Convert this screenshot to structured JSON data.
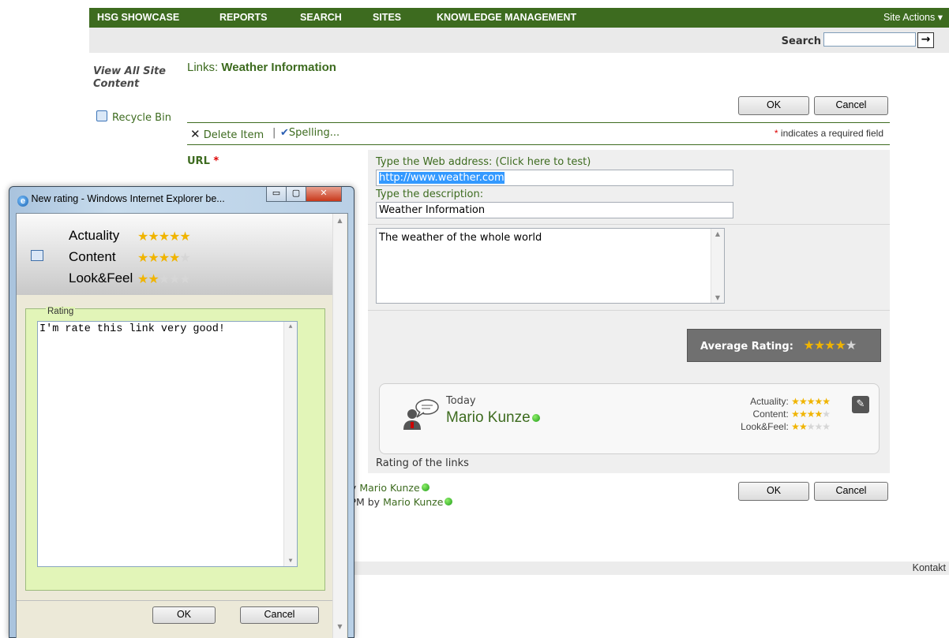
{
  "nav": {
    "items": [
      "HSG SHOWCASE",
      "REPORTS",
      "SEARCH",
      "SITES",
      "KNOWLEDGE MANAGEMENT"
    ],
    "site_actions": "Site Actions ▾"
  },
  "search": {
    "label": "Search",
    "value": "",
    "go_symbol": "→"
  },
  "leftnav": {
    "view_all": "View All Site Content",
    "recycle_bin": "Recycle Bin"
  },
  "page": {
    "title_prefix": "Links: ",
    "title_name": "Weather Information"
  },
  "buttons": {
    "ok": "OK",
    "cancel": "Cancel"
  },
  "toolbar": {
    "delete_item": "Delete Item",
    "separator": "|",
    "spelling": "Spelling...",
    "required_star": "*",
    "required_text": " indicates a required field"
  },
  "form": {
    "url_label": "URL",
    "url_required": "*",
    "web_address_label": "Type the Web address: (Click here to test)",
    "url_value": "http://www.weather.com",
    "description_label": "Type the description:",
    "description_value": "Weather Information",
    "notes_value": "The weather of the whole world",
    "average_rating_label": "Average Rating:",
    "average_rating_stars": 4,
    "rating_caption": "Rating of the links"
  },
  "review": {
    "date": "Today",
    "author": "Mario Kunze",
    "criteria": [
      {
        "label": "Actuality:",
        "stars": 5
      },
      {
        "label": "Content:",
        "stars": 4
      },
      {
        "label": "Look&Feel:",
        "stars": 2
      }
    ]
  },
  "history": {
    "created_by_prefix": "by ",
    "created_by": "Mario Kunze",
    "modified_prefix": "l PM  by ",
    "modified_by": "Mario Kunze"
  },
  "footer": {
    "kontakt": "Kontakt"
  },
  "popup": {
    "title": "New rating - Windows Internet Explorer be...",
    "criteria": [
      {
        "label": "Actuality",
        "stars": 5
      },
      {
        "label": "Content",
        "stars": 4
      },
      {
        "label": "Look&Feel",
        "stars": 2
      }
    ],
    "rating_legend": "Rating",
    "rating_text": "I'm rate this link very good!",
    "ok": "OK",
    "cancel": "Cancel"
  },
  "colors": {
    "brand_green": "#3d6b1f",
    "star": "#f0b400",
    "selection": "#3399ff"
  }
}
